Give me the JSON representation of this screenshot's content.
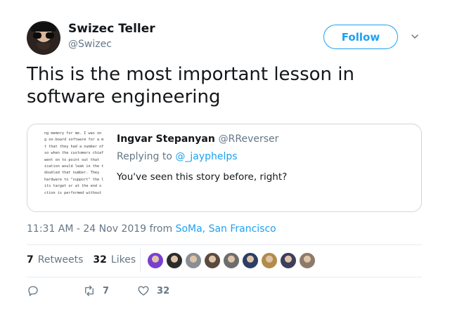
{
  "author": {
    "name": "Swizec Teller",
    "handle": "@Swizec",
    "follow_label": "Follow"
  },
  "tweet": {
    "text": "This is the most important lesson in software engineering"
  },
  "quote": {
    "name": "Ingvar Stepanyan",
    "handle": "@RReverser",
    "replying_prefix": "Replying to ",
    "replying_to": "@_jayphelps",
    "text": "You've seen this story before, right?",
    "thumbnail_lines": [
      "ng memory for me.  I was on",
      "g on-board software for a m",
      "t that they had a number of",
      "so when the customers chief",
      " went on to point out that",
      "ication would leak in the t",
      "doubled that number.  They",
      "hardware to \"support\" the l",
      " its target or at the end o",
      "ction is performed without"
    ]
  },
  "meta": {
    "time": "11:31 AM - 24 Nov 2019 from ",
    "location": "SoMa, San Francisco"
  },
  "stats": {
    "retweets_count": "7",
    "retweets_label": "Retweets",
    "likes_count": "32",
    "likes_label": "Likes"
  },
  "likers": [
    {
      "name": "liker-1",
      "color": "#7a3fd1"
    },
    {
      "name": "liker-2",
      "color": "#2b2b2b"
    },
    {
      "name": "liker-3",
      "color": "#8a8f96"
    },
    {
      "name": "liker-4",
      "color": "#5a4a40"
    },
    {
      "name": "liker-5",
      "color": "#6d6d6d"
    },
    {
      "name": "liker-6",
      "color": "#2c3e66"
    },
    {
      "name": "liker-7",
      "color": "#b38b4a"
    },
    {
      "name": "liker-8",
      "color": "#3d3d5c"
    },
    {
      "name": "liker-9",
      "color": "#8c7a6b"
    }
  ],
  "actions": {
    "reply_count": "",
    "retweet_count": "7",
    "like_count": "32"
  },
  "colors": {
    "accent": "#1da1f2",
    "secondary_text": "#657786",
    "border": "#ccd6dd"
  }
}
